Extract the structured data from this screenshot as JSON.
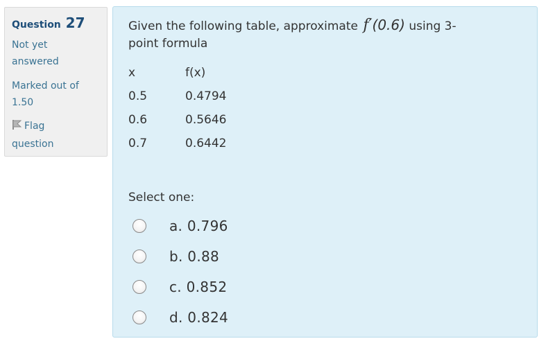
{
  "info": {
    "question_prefix": "Question",
    "question_number": "27",
    "state_line1": "Not yet",
    "state_line2": "answered",
    "grade_line1": "Marked out of",
    "grade_line2": "1.50",
    "flag_line1": "Flag",
    "flag_line2": "question"
  },
  "question": {
    "text_before": "Given the following table, approximate",
    "func": "f",
    "prime": "′",
    "arg": "(0.6)",
    "text_after_1": "using 3-",
    "text_after_2": "point formula"
  },
  "table": {
    "headers": [
      "x",
      "f(x)"
    ],
    "rows": [
      [
        "0.5",
        "0.4794"
      ],
      [
        "0.6",
        "0.5646"
      ],
      [
        "0.7",
        "0.6442"
      ]
    ]
  },
  "prompt": "Select one:",
  "options": [
    {
      "label": "a. 0.796"
    },
    {
      "label": "b. 0.88"
    },
    {
      "label": "c. 0.852"
    },
    {
      "label": "d. 0.824"
    }
  ]
}
